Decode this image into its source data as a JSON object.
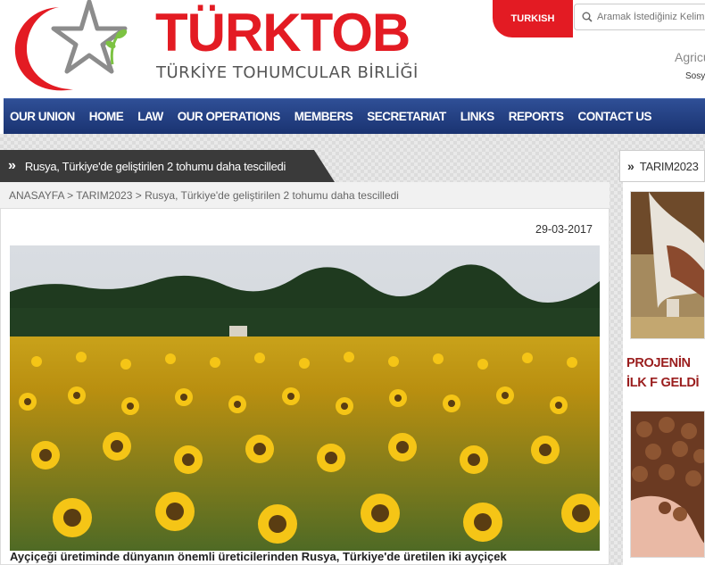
{
  "header": {
    "brand_title": "TÜRKTOB",
    "brand_subtitle": "TÜRKİYE TOHUMCULAR BİRLİĞİ",
    "language_tab": "TURKISH",
    "search_placeholder": "Aramak İstediğiniz Kelime",
    "agri_text": "Agricu",
    "sosy_text": "Sosy"
  },
  "nav": {
    "items": [
      "OUR UNION",
      "HOME",
      "LAW",
      "OUR OPERATIONS",
      "MEMBERS",
      "SECRETARIAT",
      "LINKS",
      "REPORTS",
      "CONTACT US"
    ]
  },
  "article": {
    "title": "Rusya, Türkiye'de geliştirilen 2 tohumu daha tescilledi",
    "breadcrumb": "ANASAYFA > TARIM2023 > Rusya, Türkiye'de geliştirilen 2 tohumu daha tescilledi",
    "date": "29-03-2017",
    "caption": "Ayçiçeği üretiminde dünyanın önemli üreticilerinden Rusya, Türkiye'de üretilen iki ayçiçek"
  },
  "sidebar": {
    "title": "TARIM2023",
    "headline": "PROJENİN İLK F GELDİ"
  },
  "colors": {
    "brand_red": "#e31b23",
    "nav_blue": "#1f3a7d",
    "title_bar": "#3a3a3a",
    "sidebar_headline": "#9a1d1d"
  }
}
